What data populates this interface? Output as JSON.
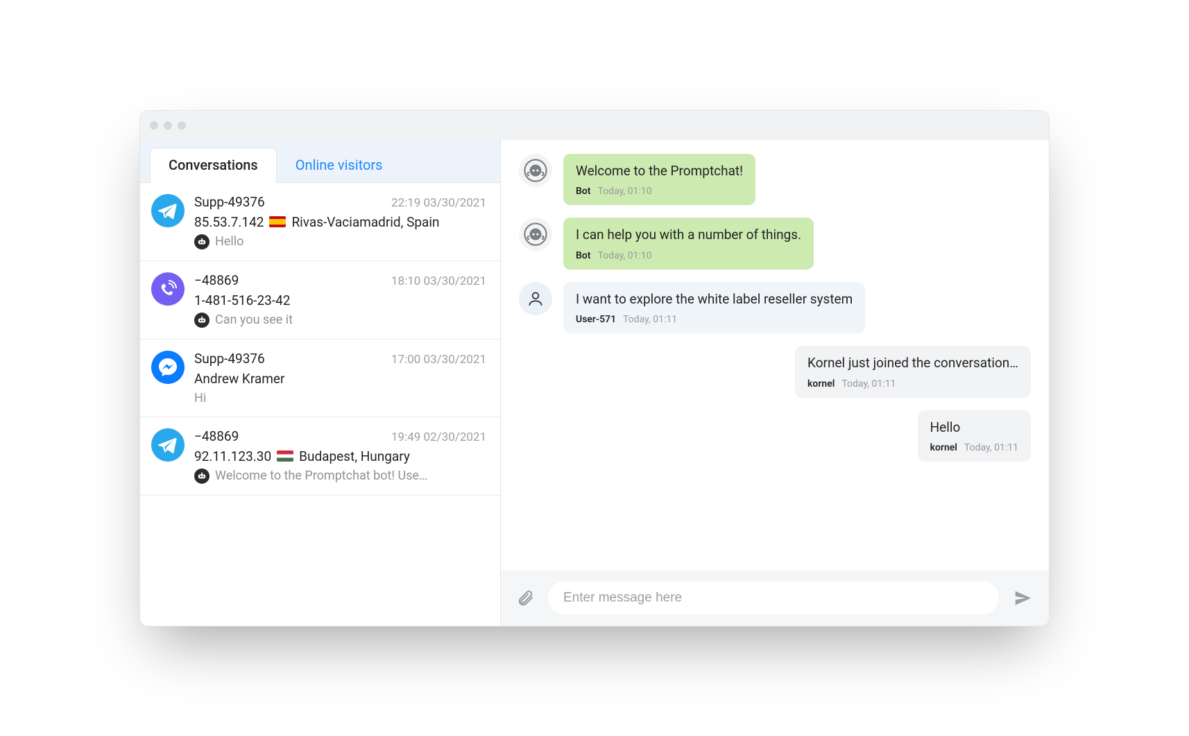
{
  "tabs": {
    "active": "Conversations",
    "inactive": "Online visitors"
  },
  "conversations": [
    {
      "platform": "telegram",
      "name": "Supp-49376",
      "timestamp": "22:19 03/30/2021",
      "line2": "85.53.7.142",
      "flag": "es",
      "location": "Rivas-Vaciamadrid, Spain",
      "last_icon": "bot",
      "last": "Hello"
    },
    {
      "platform": "viber",
      "name": "−48869",
      "timestamp": "18:10 03/30/2021",
      "line2": "1-481-516-23-42",
      "flag": null,
      "location": null,
      "last_icon": "bot",
      "last": "Can you see it"
    },
    {
      "platform": "messenger",
      "name": "Supp-49376",
      "timestamp": "17:00 03/30/2021",
      "line2": "Andrew Kramer",
      "flag": null,
      "location": null,
      "last_icon": null,
      "last": "Hi"
    },
    {
      "platform": "telegram",
      "name": "−48869",
      "timestamp": "19:49 02/30/2021",
      "line2": "92.11.123.30",
      "flag": "hu",
      "location": "Budapest, Hungary",
      "last_icon": "bot",
      "last": "Welcome to the Promptchat bot! Use…"
    }
  ],
  "thread": [
    {
      "side": "left",
      "kind": "bot",
      "avatar": "bot",
      "text": "Welcome to the Promptchat!",
      "sender": "Bot",
      "time": "Today, 01:10"
    },
    {
      "side": "left",
      "kind": "bot",
      "avatar": "bot",
      "text": "I can help you with a number of things.",
      "sender": "Bot",
      "time": "Today, 01:10"
    },
    {
      "side": "left",
      "kind": "user",
      "avatar": "user",
      "text": "I want to explore the white label reseller system",
      "sender": "User-571",
      "time": "Today, 01:11"
    },
    {
      "side": "right",
      "kind": "agent",
      "avatar": null,
      "text": "Kornel just joined the conversation…",
      "sender": "kornel",
      "time": "Today, 01:11"
    },
    {
      "side": "right",
      "kind": "agent",
      "avatar": null,
      "text": "Hello",
      "sender": "kornel",
      "time": "Today, 01:11"
    }
  ],
  "composer": {
    "placeholder": "Enter message here"
  }
}
